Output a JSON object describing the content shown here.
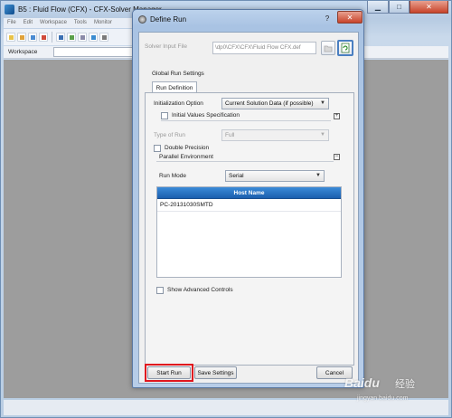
{
  "main_window": {
    "title": "B5 : Fluid Flow (CFX) - CFX-Solver Manager",
    "menu": [
      "File",
      "Edit",
      "Workspace",
      "Tools",
      "Monitor"
    ],
    "workspace_label": "Workspace"
  },
  "dialog": {
    "title": "Define Run",
    "help_glyph": "?",
    "close_glyph": "✕",
    "solver_input_file_label": "Solver Input File",
    "solver_input_file_value": "\\dp0\\CFX\\CFX\\Fluid Flow CFX.def",
    "global_run_settings_label": "Global Run Settings",
    "tab_label": "Run Definition",
    "initialization_option_label": "Initialization Option",
    "initialization_option_value": "Current Solution Data (if possible)",
    "initial_values_label": "Initial Values Specification",
    "type_of_run_label": "Type of Run",
    "type_of_run_value": "Full",
    "double_precision_label": "Double Precision",
    "parallel_environment_label": "Parallel Environment",
    "run_mode_label": "Run Mode",
    "run_mode_value": "Serial",
    "host_table": {
      "header": "Host Name",
      "rows": [
        "PC-20131030SMTD"
      ]
    },
    "show_advanced_label": "Show Advanced Controls",
    "start_run_label": "Start Run",
    "save_settings_label": "Save Settings",
    "cancel_label": "Cancel"
  },
  "colors": {
    "highlight": "#e0161e",
    "table_header": "#1b5fae",
    "workspace_bg": "#9d9d9d"
  },
  "watermark": {
    "brand": "Baidu",
    "product": "经验",
    "url": "jingyan.baidu.com"
  }
}
